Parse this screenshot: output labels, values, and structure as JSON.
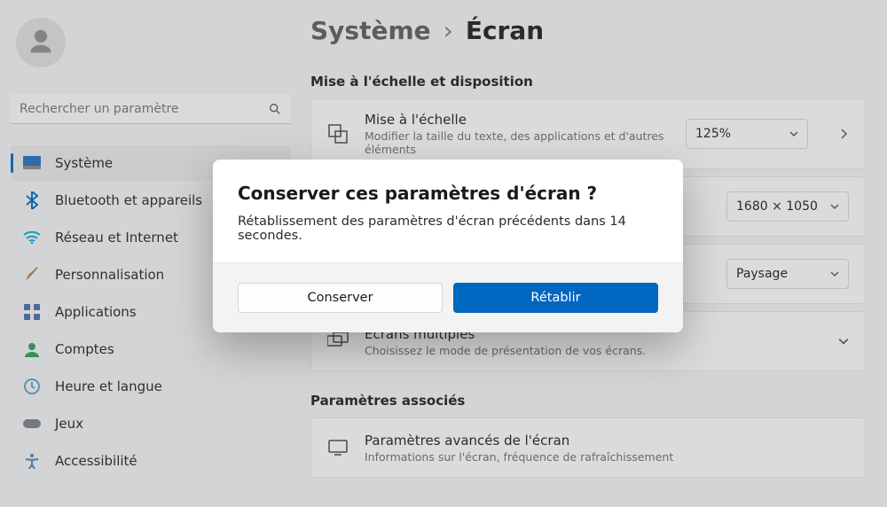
{
  "search": {
    "placeholder": "Rechercher un paramètre"
  },
  "nav": {
    "items": [
      {
        "label": "Système"
      },
      {
        "label": "Bluetooth et appareils"
      },
      {
        "label": "Réseau et Internet"
      },
      {
        "label": "Personnalisation"
      },
      {
        "label": "Applications"
      },
      {
        "label": "Comptes"
      },
      {
        "label": "Heure et langue"
      },
      {
        "label": "Jeux"
      },
      {
        "label": "Accessibilité"
      }
    ]
  },
  "breadcrumb": {
    "parent": "Système",
    "sep": "›",
    "current": "Écran"
  },
  "section1": {
    "title": "Mise à l'échelle et disposition",
    "scale": {
      "title": "Mise à l'échelle",
      "sub": "Modifier la taille du texte, des applications et d'autres éléments",
      "value": "125%"
    },
    "resolution": {
      "value": "1680 × 1050"
    },
    "orientation": {
      "value": "Paysage"
    },
    "multi": {
      "title": "Écrans multiples",
      "sub": "Choisissez le mode de présentation de vos écrans."
    }
  },
  "section2": {
    "title": "Paramètres associés",
    "advanced": {
      "title": "Paramètres avancés de l'écran",
      "sub": "Informations sur l'écran, fréquence de rafraîchissement"
    }
  },
  "dialog": {
    "title": "Conserver ces paramètres d'écran ?",
    "message": "Rétablissement des paramètres d'écran précédents dans 14 secondes.",
    "keep": "Conserver",
    "revert": "Rétablir"
  }
}
